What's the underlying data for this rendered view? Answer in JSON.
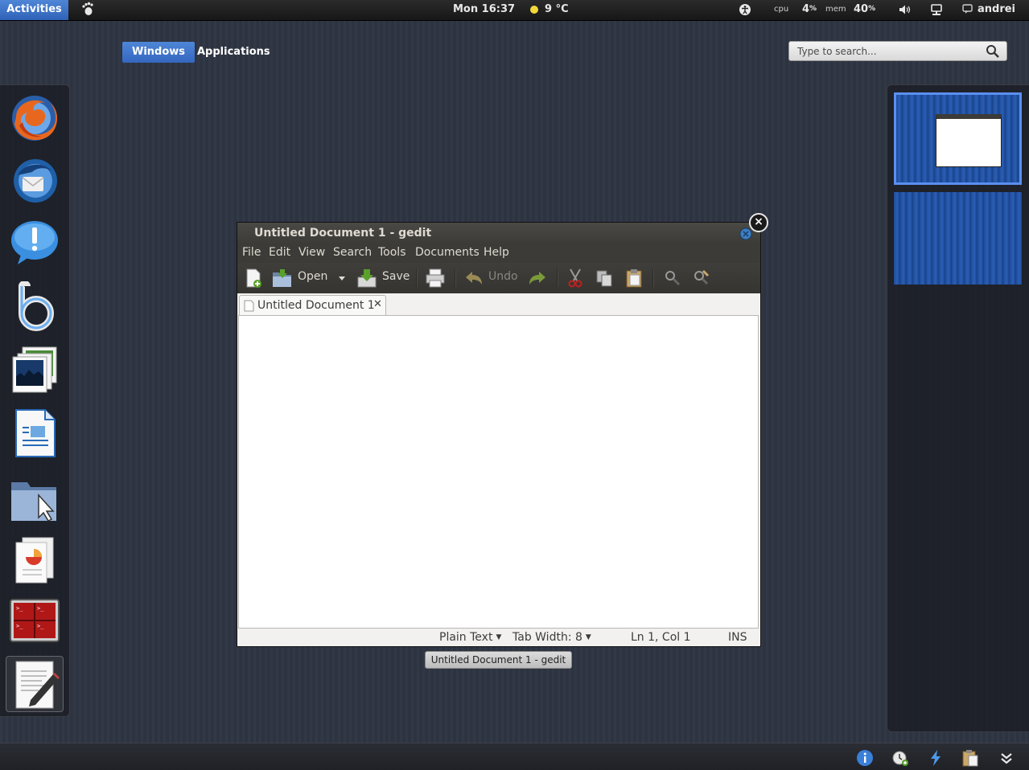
{
  "topbar": {
    "activities": "Activities",
    "clock": "Mon 16:37",
    "weather": "9 °C",
    "cpu_label": "cpu",
    "cpu_value": "4",
    "mem_label": "mem",
    "mem_value": "40",
    "percent": "%",
    "user": "andrei"
  },
  "overview": {
    "tabs": [
      "Windows",
      "Applications"
    ],
    "search_placeholder": "Type to search..."
  },
  "dash": {
    "apps": [
      "firefox-icon",
      "thunderbird-icon",
      "empathy-icon",
      "banshee-icon",
      "shotwell-icon",
      "libreoffice-writer-icon",
      "files-icon",
      "libreoffice-impress-icon",
      "terminal-icon",
      "gedit-icon"
    ]
  },
  "window": {
    "title": "Untitled Document 1 - gedit",
    "menu": [
      "File",
      "Edit",
      "View",
      "Search",
      "Tools",
      "Documents",
      "Help"
    ],
    "toolbar": {
      "open": "Open",
      "save": "Save",
      "undo": "Undo"
    },
    "tab_label": "Untitled Document 1",
    "status": {
      "language": "Plain Text",
      "tab_width": "Tab Width:",
      "tab_width_value": "8",
      "position": "Ln 1, Col 1",
      "mode": "INS"
    },
    "caption": "Untitled Document 1 - gedit",
    "close_glyph": "×",
    "tab_close_glyph": "✕"
  },
  "workspaces": {
    "count": 2,
    "active": 1
  },
  "tray": [
    "info-icon",
    "clock-add-icon",
    "power-icon",
    "clipboard-icon",
    "expand-icon"
  ],
  "colors": {
    "accent": "#3567c0",
    "panel": "#171717",
    "window_chrome": "#3c3b37"
  }
}
